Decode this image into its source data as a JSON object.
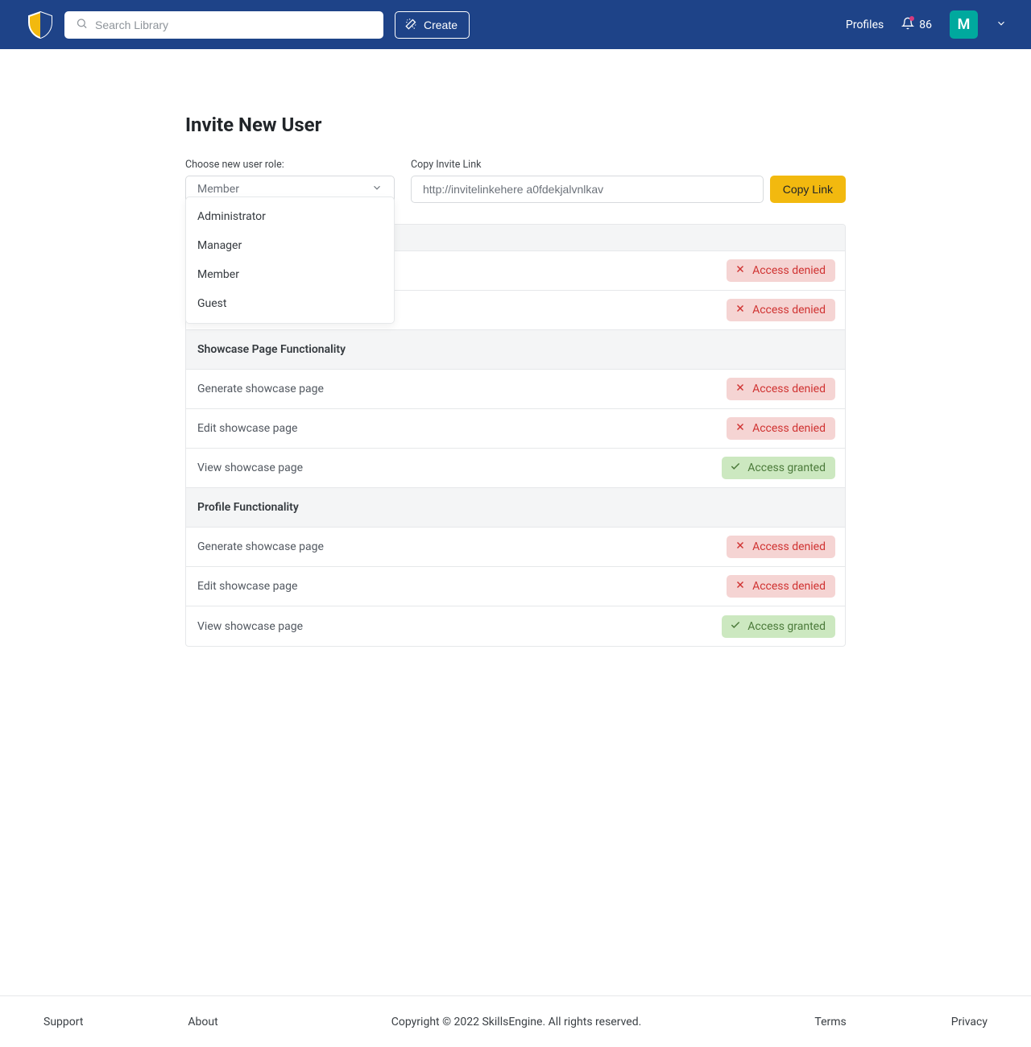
{
  "header": {
    "search_placeholder": "Search Library",
    "create_label": "Create",
    "profiles_label": "Profiles",
    "notif_count": "86",
    "avatar_initial": "M"
  },
  "page": {
    "title": "Invite New User",
    "role_label": "Choose new user role:",
    "role_selected": "Member",
    "link_label": "Copy Invite Link",
    "link_value": "http://invitelinkehere a0fdekjalvnlkav",
    "copy_btn": "Copy Link"
  },
  "dropdown": {
    "options": [
      "Administrator",
      "Manager",
      "Member",
      "Guest"
    ]
  },
  "permissions": {
    "sections": [
      {
        "title": "",
        "rows": [
          {
            "label": "",
            "status": "denied"
          },
          {
            "label": "",
            "status": "denied"
          }
        ]
      },
      {
        "title": "Showcase Page Functionality",
        "rows": [
          {
            "label": "Generate showcase page",
            "status": "denied"
          },
          {
            "label": "Edit showcase page",
            "status": "denied"
          },
          {
            "label": "View showcase page",
            "status": "granted"
          }
        ]
      },
      {
        "title": "Profile Functionality",
        "rows": [
          {
            "label": "Generate showcase page",
            "status": "denied"
          },
          {
            "label": "Edit showcase page",
            "status": "denied"
          },
          {
            "label": "View showcase page",
            "status": "granted"
          }
        ]
      }
    ]
  },
  "status_labels": {
    "denied": "Access denied",
    "granted": "Access granted"
  },
  "footer": {
    "support": "Support",
    "about": "About",
    "copyright": "Copyright © 2022 SkillsEngine. All rights reserved.",
    "terms": "Terms",
    "privacy": "Privacy"
  }
}
